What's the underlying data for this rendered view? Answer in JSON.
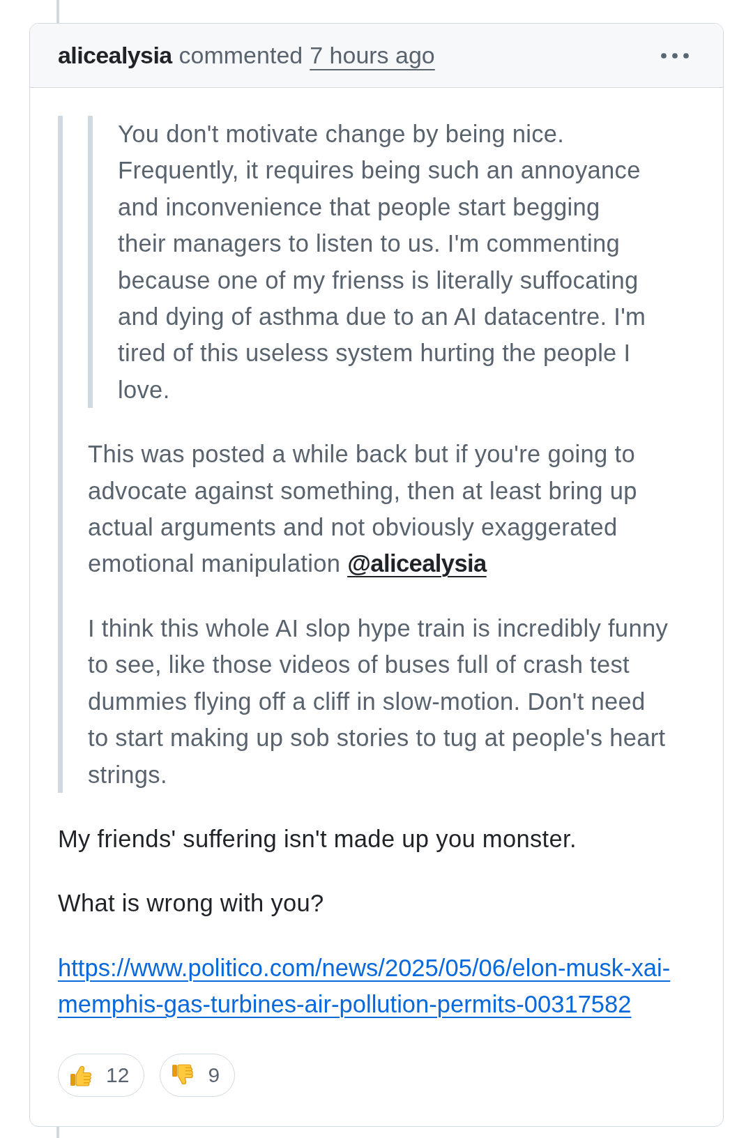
{
  "comment": {
    "author": "alicealysia",
    "action": "commented",
    "timestamp": "7 hours ago"
  },
  "body": [
    {
      "kind": "blockquote",
      "children": [
        {
          "kind": "blockquote",
          "children": [
            {
              "kind": "paragraph",
              "segments": [
                {
                  "kind": "text",
                  "text": "You don't motivate change by being nice. Frequently, it requires being such an annoyance and inconvenience that people start begging their managers to listen to us. I'm commenting because one of my frienss is literally suffocating and dying of asthma due to an AI datacentre. I'm tired of this useless system hurting the people I love."
                }
              ]
            }
          ]
        },
        {
          "kind": "paragraph",
          "segments": [
            {
              "kind": "text",
              "text": "This was posted a while back but if you're going to advocate against something, then at least bring up actual arguments and not obviously exaggerated emotional manipulation"
            },
            {
              "kind": "mention",
              "text": "@alicealysia"
            }
          ]
        },
        {
          "kind": "paragraph",
          "segments": [
            {
              "kind": "text",
              "text": "I think this whole AI slop hype train is incredibly funny to see, like those videos of buses full of crash test dummies flying off a cliff in slow-motion. Don't need to start making up sob stories to tug at people's heart strings."
            }
          ]
        }
      ]
    },
    {
      "kind": "paragraph",
      "segments": [
        {
          "kind": "text",
          "text": "My friends' suffering isn't made up you monster."
        }
      ]
    },
    {
      "kind": "paragraph",
      "segments": [
        {
          "kind": "text",
          "text": "What is wrong with you?"
        }
      ]
    },
    {
      "kind": "paragraph",
      "segments": [
        {
          "kind": "link",
          "text": "https://www.politico.com/news/2025/05/06/elon-musk-xai-memphis-gas-turbines-air-pollution-permits-00317582"
        }
      ]
    }
  ],
  "reactions": [
    {
      "kind": "thumbs_up",
      "count": "12",
      "selected": false
    },
    {
      "kind": "thumbs_down",
      "count": "9",
      "selected": false
    }
  ]
}
